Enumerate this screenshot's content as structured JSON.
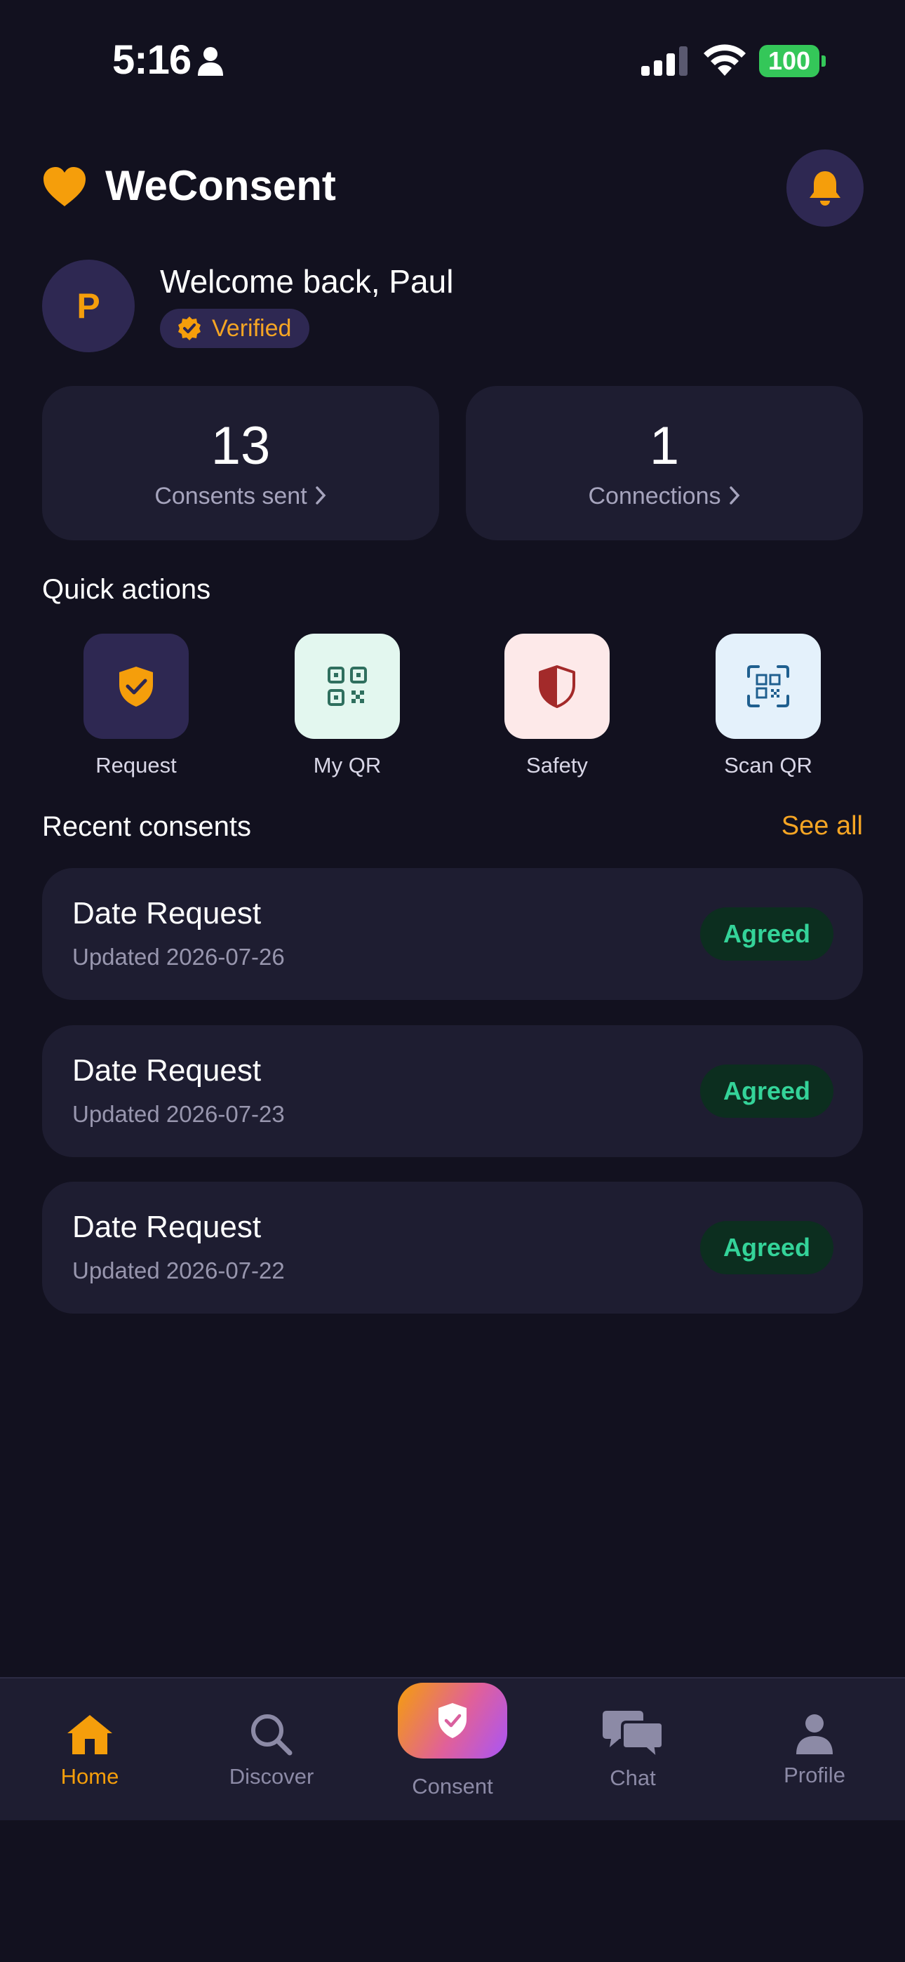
{
  "status_bar": {
    "time": "5:16",
    "battery": "100"
  },
  "header": {
    "app_title": "WeConsent"
  },
  "user": {
    "avatar_initial": "P",
    "welcome": "Welcome back, Paul",
    "verified_label": "Verified"
  },
  "stats": [
    {
      "value": "13",
      "label": "Consents sent"
    },
    {
      "value": "1",
      "label": "Connections"
    }
  ],
  "quick_actions": {
    "title": "Quick actions",
    "items": [
      {
        "label": "Request",
        "icon": "shield-check-icon"
      },
      {
        "label": "My QR",
        "icon": "qr-code-icon"
      },
      {
        "label": "Safety",
        "icon": "shield-half-icon"
      },
      {
        "label": "Scan QR",
        "icon": "scan-qr-icon"
      }
    ]
  },
  "recent": {
    "title": "Recent consents",
    "see_all": "See all",
    "items": [
      {
        "title": "Date Request",
        "updated": "Updated 2026-07-26",
        "status": "Agreed"
      },
      {
        "title": "Date Request",
        "updated": "Updated 2026-07-23",
        "status": "Agreed"
      },
      {
        "title": "Date Request",
        "updated": "Updated 2026-07-22",
        "status": "Agreed"
      }
    ]
  },
  "nav": {
    "home": "Home",
    "discover": "Discover",
    "consent": "Consent",
    "chat": "Chat",
    "profile": "Profile"
  },
  "colors": {
    "background": "#12111f",
    "card": "#1e1d31",
    "accent": "#f59e0b",
    "success": "#34d399"
  }
}
